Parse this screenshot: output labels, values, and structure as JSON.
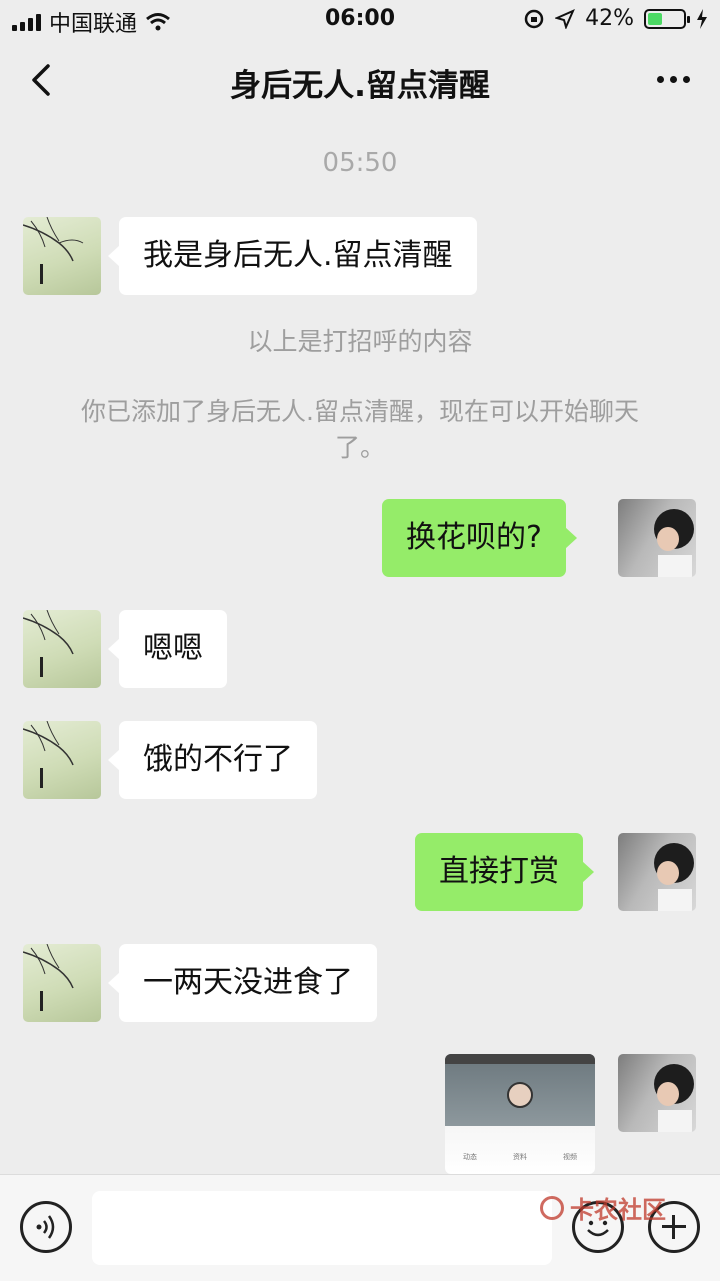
{
  "status_bar": {
    "carrier": "中国联通",
    "time": "06:00",
    "battery_percent": "42%",
    "battery_level": 0.42,
    "battery_color": "#4cd964"
  },
  "header": {
    "title": "身后无人.留点清醒",
    "back_icon": "chevron-left-icon",
    "more_icon": "more-dots-icon"
  },
  "chat": {
    "timestamp": "05:50",
    "msg_greeting": "我是身后无人.留点清醒",
    "sys_greeting": "以上是打招呼的内容",
    "sys_added": "你已添加了身后无人.留点清醒，现在可以开始聊天了。",
    "msg_out_1": "换花呗的?",
    "msg_in_2": "嗯嗯",
    "msg_in_3": "饿的不行了",
    "msg_out_2": "直接打赏",
    "msg_in_4": "一两天没进食了",
    "image_tabs": [
      "动态",
      "资料",
      "视频"
    ]
  },
  "input_bar": {
    "voice_icon": "voice-icon",
    "emoji_icon": "emoji-icon",
    "plus_icon": "plus-icon"
  },
  "watermark": {
    "text": "卡农社区"
  },
  "colors": {
    "background": "#ededed",
    "outgoing_bubble": "#95ec69",
    "incoming_bubble": "#ffffff"
  }
}
